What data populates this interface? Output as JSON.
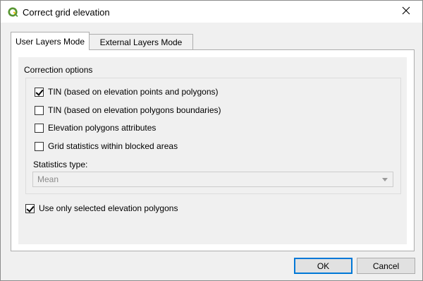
{
  "window": {
    "title": "Correct grid elevation",
    "icon": "qgis-logo-icon",
    "close_glyph": "✕"
  },
  "tabs": [
    {
      "label": "User Layers Mode",
      "active": true
    },
    {
      "label": "External Layers Mode",
      "active": false
    }
  ],
  "panel": {
    "group_title": "Correction options",
    "options": [
      {
        "label": "TIN (based on elevation points and polygons)",
        "checked": true
      },
      {
        "label": "TIN (based on elevation polygons boundaries)",
        "checked": false
      },
      {
        "label": "Elevation polygons attributes",
        "checked": false
      },
      {
        "label": "Grid statistics within blocked areas",
        "checked": false
      }
    ],
    "statistics_type_label": "Statistics type:",
    "statistics_type_value": "Mean",
    "use_selected": {
      "label": "Use only selected elevation polygons",
      "checked": true
    }
  },
  "buttons": {
    "ok": "OK",
    "cancel": "Cancel"
  },
  "colors": {
    "accent": "#0078d7",
    "qgis_green": "#589632",
    "qgis_yellow": "#ee7913"
  }
}
